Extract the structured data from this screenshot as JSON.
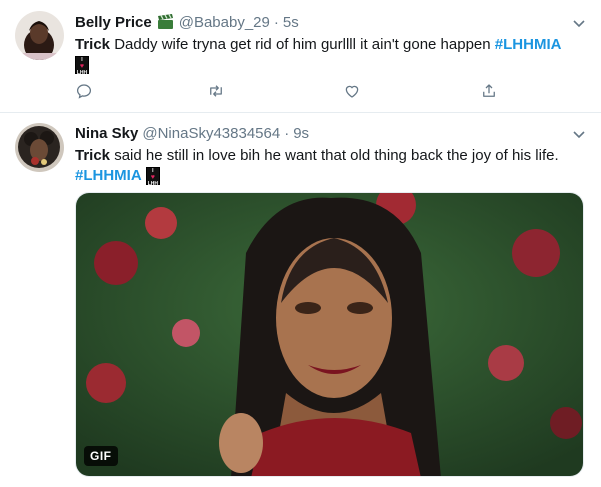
{
  "tweets": [
    {
      "name": "Belly Price",
      "badge": "clapper-board-icon",
      "handle": "@Bababy_29",
      "dot": "·",
      "time": "5s",
      "text_bold": "Trick",
      "text_rest": " Daddy wife tryna get rid of him gurllll it ain't gone happen ",
      "hashtag": "#LHHMIA",
      "emoji": {
        "top": "I",
        "heart": "♥",
        "bottom": "LHH"
      }
    },
    {
      "name": "Nina Sky",
      "handle": "@NinaSky43834564",
      "dot": "·",
      "time": "9s",
      "text_bold": "Trick",
      "text_rest": " said he still in love bih he want that old thing back  the joy of his life.",
      "hashtag": "#LHHMIA",
      "emoji": {
        "top": "I",
        "heart": "♥",
        "bottom": "LHH"
      },
      "media_label": "GIF"
    }
  ],
  "actions": [
    "reply-icon",
    "retweet-icon",
    "like-icon",
    "share-icon"
  ]
}
